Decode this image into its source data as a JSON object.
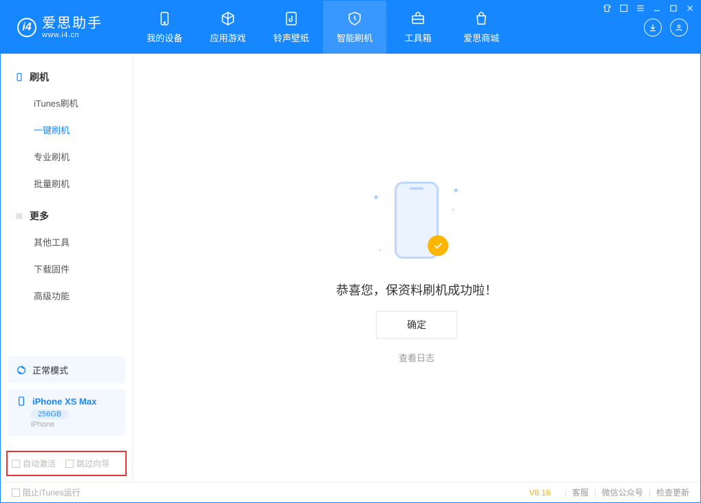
{
  "app": {
    "name_cn": "爱思助手",
    "name_en": "www.i4.cn"
  },
  "tabs": {
    "device": "我的设备",
    "apps": "应用游戏",
    "rings": "铃声壁纸",
    "flash": "智能刷机",
    "tools": "工具箱",
    "store": "爱思商城"
  },
  "sidebar": {
    "group_flash": "刷机",
    "items_flash": {
      "itunes": "iTunes刷机",
      "onekey": "一键刷机",
      "pro": "专业刷机",
      "batch": "批量刷机"
    },
    "group_more": "更多",
    "items_more": {
      "other": "其他工具",
      "firmware": "下载固件",
      "advanced": "高级功能"
    }
  },
  "mode": {
    "icon_label": "正常模式"
  },
  "device": {
    "name": "iPhone XS Max",
    "capacity": "256GB",
    "type": "iPhone"
  },
  "options": {
    "auto_activate": "自动激活",
    "skip_guide": "跳过向导"
  },
  "result": {
    "message": "恭喜您，保资料刷机成功啦！",
    "ok": "确定",
    "log": "查看日志"
  },
  "statusbar": {
    "block_itunes": "阻止iTunes运行",
    "version": "V8.16",
    "support": "客服",
    "wechat": "微信公众号",
    "update": "检查更新"
  }
}
